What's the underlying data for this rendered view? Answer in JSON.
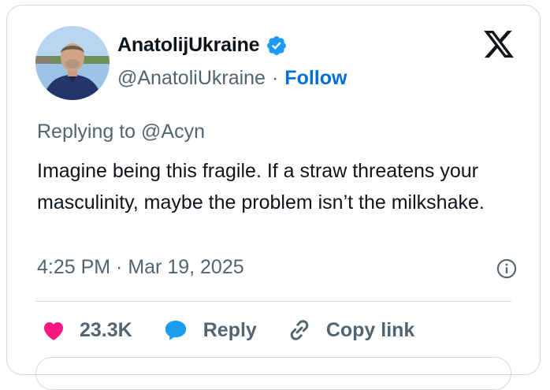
{
  "tweet": {
    "display_name": "AnatolijUkraine",
    "handle": "@AnatoliUkraine",
    "separator": "·",
    "follow_label": "Follow",
    "replying_to": "Replying to @Acyn",
    "text": "Imagine being this fragile. If a straw threatens your masculinity, maybe the problem isn’t the milkshake.",
    "timestamp": "4:25 PM · Mar 19, 2025"
  },
  "actions": {
    "like_count": "23.3K",
    "reply_label": "Reply",
    "copy_link_label": "Copy link"
  },
  "icons": {
    "verified": "verified-badge-icon",
    "x_logo": "x-logo-icon",
    "info": "info-icon",
    "like": "heart-icon",
    "reply": "speech-bubble-icon",
    "copy_link": "link-icon"
  },
  "colors": {
    "accent": "#1d9bf0",
    "follow": "#006fd6",
    "heart": "#f91880",
    "muted_text": "#536471",
    "border": "#cfd9de"
  }
}
